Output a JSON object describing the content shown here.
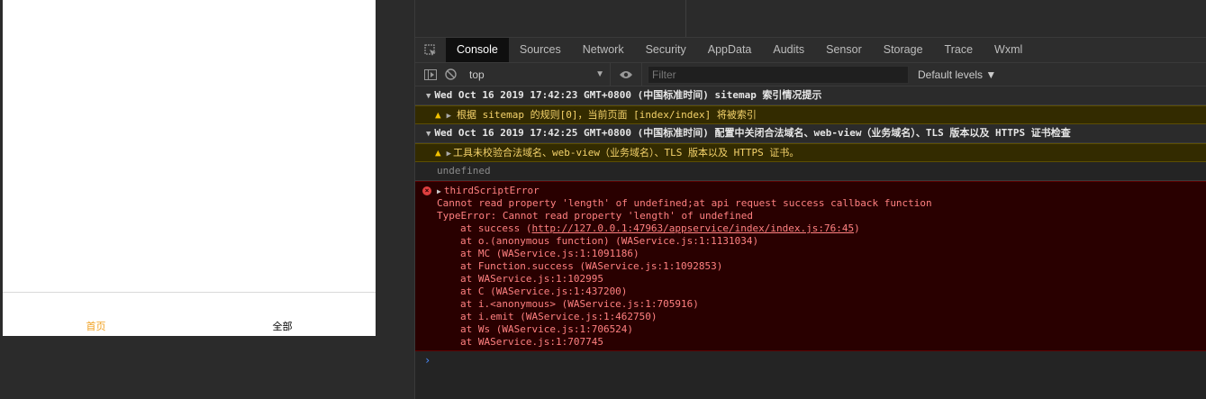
{
  "simulator": {
    "tabbar": {
      "home_label": "首页",
      "all_label": "全部"
    }
  },
  "devtools": {
    "tabs": [
      "Console",
      "Sources",
      "Network",
      "Security",
      "AppData",
      "Audits",
      "Sensor",
      "Storage",
      "Trace",
      "Wxml"
    ],
    "toolbar": {
      "context": "top",
      "filter_placeholder": "Filter",
      "levels": "Default levels ▼"
    },
    "console": {
      "group1": "Wed Oct 16 2019 17:42:23 GMT+0800 (中国标准时间) sitemap 索引情况提示",
      "warn1": "根据 sitemap 的规则[0]，当前页面 [index/index] 将被索引",
      "group2": "Wed Oct 16 2019 17:42:25 GMT+0800 (中国标准时间) 配置中关闭合法域名、web-view（业务域名）、TLS 版本以及 HTTPS 证书检查",
      "warn2": "工具未校验合法域名、web-view（业务域名）、TLS 版本以及 HTTPS 证书。",
      "undefined_text": "undefined",
      "error": {
        "title": "thirdScriptError",
        "message": "Cannot read property 'length' of undefined;at api request success callback function",
        "type_error": "TypeError: Cannot read property 'length' of undefined",
        "stack0_prefix": "at success (",
        "stack0_link": "http://127.0.0.1:47963/appservice/index/index.js:76:45",
        "stack0_suffix": ")",
        "stack": [
          "at o.(anonymous function) (WAService.js:1:1131034)",
          "at MC (WAService.js:1:1091186)",
          "at Function.success (WAService.js:1:1092853)",
          "at WAService.js:1:102995",
          "at C (WAService.js:1:437200)",
          "at i.<anonymous> (WAService.js:1:705916)",
          "at i.emit (WAService.js:1:462750)",
          "at Ws (WAService.js:1:706524)",
          "at WAService.js:1:707745"
        ]
      },
      "prompt": "›"
    }
  },
  "colors": {
    "accent_tab": "#f0a020",
    "error_bg": "#290000",
    "warn_bg": "#332b00"
  }
}
